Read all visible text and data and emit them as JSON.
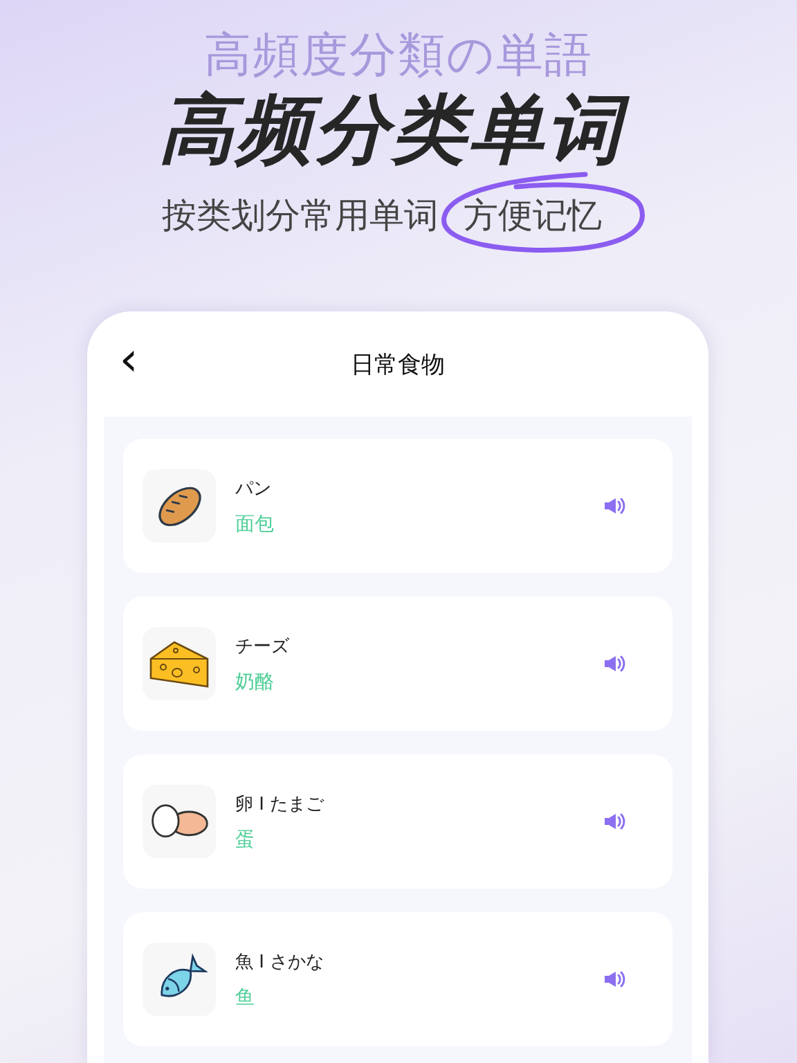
{
  "hero": {
    "background_text": "高頻度分類の単語",
    "title": "高频分类单词",
    "subtitle": "按类划分常用单词",
    "highlight": "方便记忆"
  },
  "screen": {
    "title": "日常食物",
    "back": "‹",
    "words": [
      {
        "word": "パン",
        "meaning": "面包"
      },
      {
        "word": "チーズ",
        "meaning": "奶酪"
      },
      {
        "word": "卵 I たまご",
        "meaning": "蛋"
      },
      {
        "word": "魚 I さかな",
        "meaning": "鱼"
      }
    ]
  }
}
